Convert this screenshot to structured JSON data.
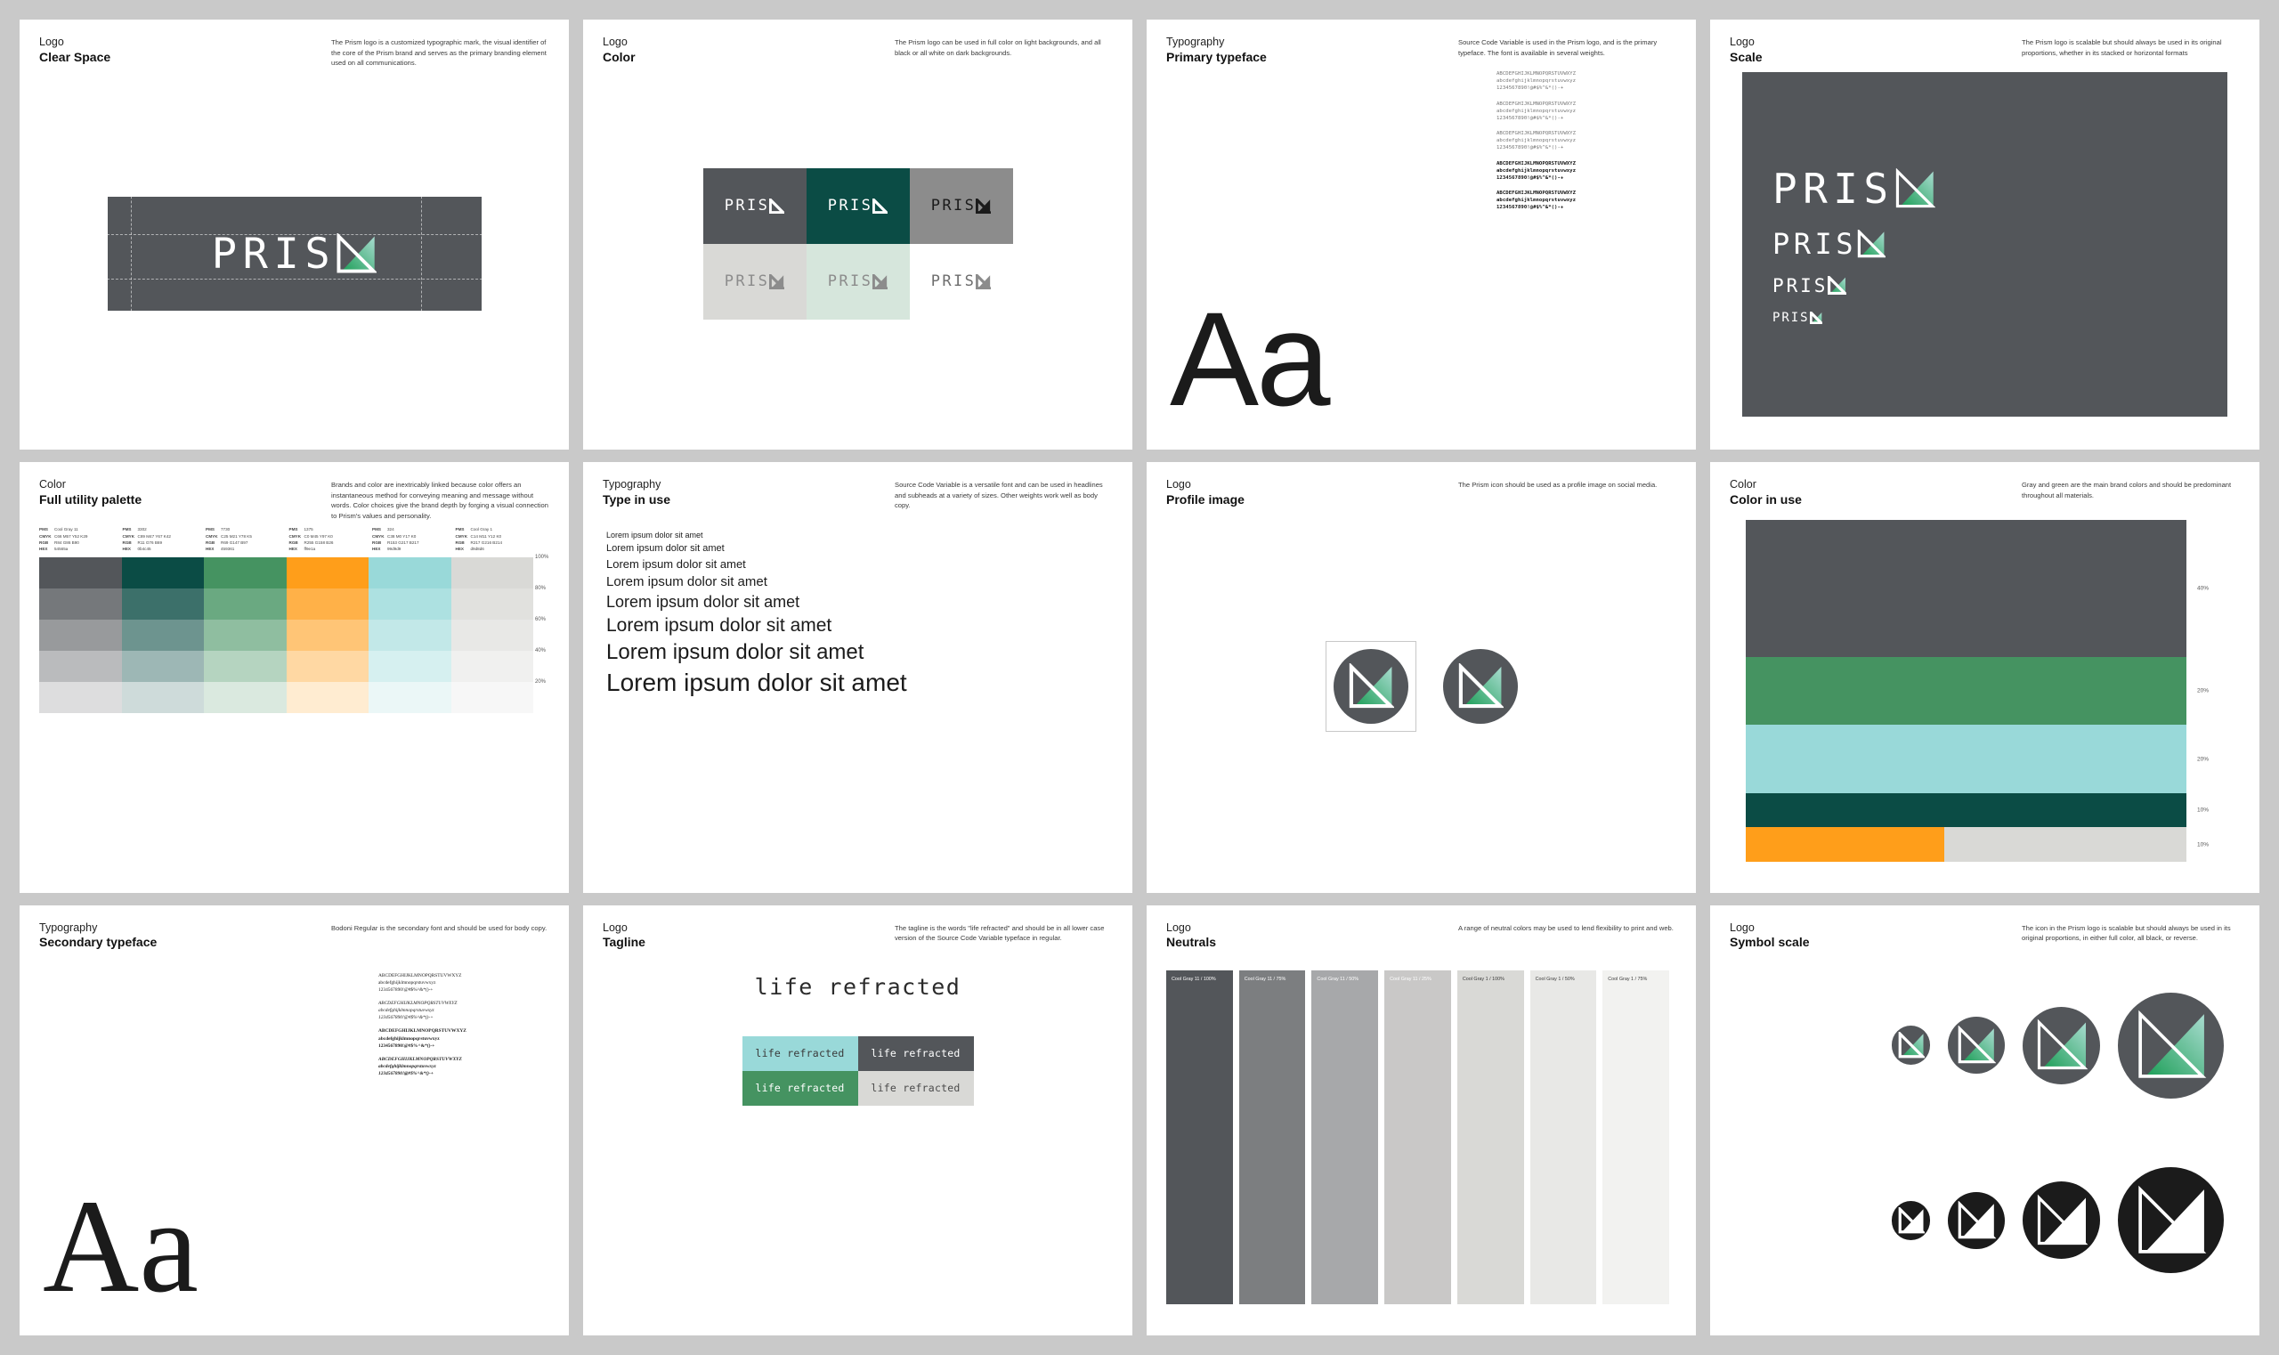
{
  "brand": {
    "name": "Prism",
    "wordmark": "PRIS",
    "tagline": "life refracted"
  },
  "colors": {
    "cool_gray_11": "#53565a",
    "dark_green": "#0b4c45",
    "green": "#459361",
    "orange": "#ff9e1a",
    "light_blue": "#99d9d9",
    "cool_gray_1": "#d9d9d6",
    "mark_green": "#1c9e57",
    "mark_teal": "#8fd2c4",
    "white": "#ffffff",
    "black": "#000000"
  },
  "panels": [
    {
      "kicker": "Logo",
      "title": "Clear Space",
      "desc": "The Prism logo is a customized typographic mark, the visual identifier of the core of the Prism brand and serves as the primary branding element used on all communications."
    },
    {
      "kicker": "Logo",
      "title": "Color",
      "desc": "The Prism logo can be used in full color on light backgrounds, and all black or all white on dark backgrounds.",
      "cells": [
        {
          "bg": "#53565a",
          "fg": "#ffffff",
          "mark": "white"
        },
        {
          "bg": "#0b4c45",
          "fg": "#ffffff",
          "mark": "white"
        },
        {
          "bg": "#8c8c8c",
          "fg": "#1b1b1b",
          "mark": "black"
        },
        {
          "bg": "#d9d9d6",
          "fg": "#8c8c8c",
          "mark": "gray"
        },
        {
          "bg": "#d6e6dc",
          "fg": "#8c8c8c",
          "mark": "gray"
        },
        {
          "bg": "#ffffff",
          "fg": "#6e6e6e",
          "mark": "gray"
        }
      ]
    },
    {
      "kicker": "Typography",
      "title": "Primary typeface",
      "desc": "Source Code Variable  is used in the Prism logo, and is the primary typeface. The font is available in several weights.",
      "sample": "Aa",
      "specimens": [
        {
          "weight": "light",
          "lines": [
            "ABCDEFGHIJKLMNOPQRSTUVWXYZ",
            "abcdefghijklmnopqrstuvwxyz",
            "1234567890!@#$%^&*()-+"
          ]
        },
        {
          "weight": "regular",
          "lines": [
            "ABCDEFGHIJKLMNOPQRSTUVWXYZ",
            "abcdefghijklmnopqrstuvwxyz",
            "1234567890!@#$%^&*()-+"
          ]
        },
        {
          "weight": "medium",
          "lines": [
            "ABCDEFGHIJKLMNOPQRSTUVWXYZ",
            "abcdefghijklmnopqrstuvwxyz",
            "1234567890!@#$%^&*()-+"
          ]
        },
        {
          "weight": "semibold",
          "lines": [
            "ABCDEFGHIJKLMNOPQRSTUVWXYZ",
            "abcdefghijklmnopqrstuvwxyz",
            "1234567890!@#$%^&*()-+"
          ]
        },
        {
          "weight": "bold",
          "lines": [
            "ABCDEFGHIJKLMNOPQRSTUVWXYZ",
            "abcdefghijklmnopqrstuvwxyz",
            "1234567890!@#$%^&*()-+"
          ]
        }
      ]
    },
    {
      "kicker": "Logo",
      "title": "Scale",
      "desc": "The Prism logo is scalable but should always be used in its original proportions, whether in its stacked or horizontal formats",
      "sizes": [
        46,
        32,
        21,
        14
      ]
    },
    {
      "kicker": "Color",
      "title": "Full utility palette",
      "desc": "Brands and color are inextricably linked because color offers an instantaneous method for conveying meaning and message without words. Color choices give the brand depth by forging a visual connection to Prism's values and personality.",
      "swatches": [
        {
          "pms": "Cool Gray 11",
          "cmyk": "C66 M57 Y52 K29",
          "rgb": "R84 G86 B90",
          "hex": "54565a",
          "color": "#53565a"
        },
        {
          "pms": "3302",
          "cmyk": "C89 M47 Y67 K42",
          "rgb": "R11 G76 B69",
          "hex": "0b4c45",
          "color": "#0b4c45"
        },
        {
          "pms": "7730",
          "cmyk": "C25 M21 Y78 K5",
          "rgb": "R69 G147 B97",
          "hex": "459361",
          "color": "#459361"
        },
        {
          "pms": "1375",
          "cmyk": "C0 M45 Y97 K0",
          "rgb": "R255 G158 B26",
          "hex": "ff9e1a",
          "color": "#ff9e1a"
        },
        {
          "pms": "324",
          "cmyk": "C38 M0 Y17 K0",
          "rgb": "R153 G217 B217",
          "hex": "99d9d9",
          "color": "#99d9d9"
        },
        {
          "pms": "Cool Gray 1",
          "cmyk": "C14 M11 Y12 K0",
          "rgb": "R217 G216 B214",
          "hex": "d9d8d6",
          "color": "#d9d9d6"
        }
      ],
      "tints": [
        "100%",
        "80%",
        "60%",
        "40%",
        "20%"
      ]
    },
    {
      "kicker": "Typography",
      "title": "Type in use",
      "desc": "Source Code Variable is a versatile font and can be used in headlines and subheads at a variety of sizes. Other weights work well as body copy.",
      "lines": [
        {
          "text": "Lorem ipsum dolor sit amet",
          "size": 9
        },
        {
          "text": "Lorem ipsum dolor sit amet",
          "size": 11
        },
        {
          "text": "Lorem ipsum dolor sit amet",
          "size": 13
        },
        {
          "text": "Lorem ipsum dolor sit amet",
          "size": 15
        },
        {
          "text": "Lorem ipsum dolor sit amet",
          "size": 18
        },
        {
          "text": "Lorem ipsum dolor sit amet",
          "size": 21
        },
        {
          "text": "Lorem ipsum dolor sit amet",
          "size": 24
        },
        {
          "text": "Lorem ipsum dolor sit amet",
          "size": 28
        }
      ]
    },
    {
      "kicker": "Logo",
      "title": "Profile image",
      "desc": "The Prism icon should be used as a profile image on social media."
    },
    {
      "kicker": "Color",
      "title": "Color in use",
      "desc": "Gray and green are the main brand colors and should be predominant throughout all materials.",
      "bands": [
        {
          "label": "40%",
          "color": "#53565a",
          "weight": 40
        },
        {
          "label": "20%",
          "color": "#459361",
          "weight": 20
        },
        {
          "label": "20%",
          "color": "#99d9d9",
          "weight": 20
        },
        {
          "label": "10%",
          "color": "#0b4c45",
          "weight": 10
        },
        {
          "label": "10%",
          "color": "#d9d9d6",
          "weight": 10,
          "accent": "#ff9e1a"
        }
      ]
    },
    {
      "kicker": "Typography",
      "title": "Secondary typeface",
      "desc": "Bodoni Regular is the secondary font and should be used for body copy.",
      "sample": "Aa",
      "specimens": [
        {
          "style": "regular",
          "lines": [
            "ABCDEFGHIJKLMNOPQRSTUVWXYZ",
            "abcdefghijklmnopqrstuvwxyz",
            "1234567890!@#$%^&*()-+"
          ]
        },
        {
          "style": "italic",
          "lines": [
            "ABCDEFGHIJKLMNOPQRSTUVWXYZ",
            "abcdefghijklmnopqrstuvwxyz",
            "1234567890!@#$%^&*()-+"
          ]
        },
        {
          "style": "bold",
          "lines": [
            "ABCDEFGHIJKLMNOPQRSTUVWXYZ",
            "abcdefghijklmnopqrstuvwxyz",
            "1234567890!@#$%^&*()-+"
          ]
        },
        {
          "style": "bold-italic",
          "lines": [
            "ABCDEFGHIJKLMNOPQRSTUVWXYZ",
            "abcdefghijklmnopqrstuvwxyz",
            "1234567890!@#$%^&*()-+"
          ]
        }
      ]
    },
    {
      "kicker": "Logo",
      "title": "Tagline",
      "desc": "The tagline is the words \"life refracted\" and should be in all lower case version of the Source Code Variable typeface in regular.",
      "cells": [
        {
          "bg": "#99d9d9",
          "fg": "#3a3a3a"
        },
        {
          "bg": "#53565a",
          "fg": "#ffffff"
        },
        {
          "bg": "#459361",
          "fg": "#ffffff"
        },
        {
          "bg": "#d9d9d6",
          "fg": "#4a4a4a"
        }
      ]
    },
    {
      "kicker": "Logo",
      "title": "Neutrals",
      "desc": "A range of neutral colors may be used to lend flexibility to print and web.",
      "swatches": [
        {
          "label": "Cool Gray 11 / 100%",
          "color": "#53565a",
          "fg": "#ffffff"
        },
        {
          "label": "Cool Gray 11 / 75%",
          "color": "#7c7e80",
          "fg": "#ffffff"
        },
        {
          "label": "Cool Gray 11 / 50%",
          "color": "#a7a8aa",
          "fg": "#ffffff"
        },
        {
          "label": "Cool Gray 11 / 25%",
          "color": "#c9c8c7",
          "fg": "#ffffff"
        },
        {
          "label": "Cool Gray 1 / 100%",
          "color": "#d9d9d6",
          "fg": "#3a3a3a"
        },
        {
          "label": "Cool Gray 1 / 50%",
          "color": "#e8e8e6",
          "fg": "#3a3a3a"
        },
        {
          "label": "Cool Gray 1 / 75%",
          "color": "#f2f2f0",
          "fg": "#3a3a3a"
        }
      ]
    },
    {
      "kicker": "Logo",
      "title": "Symbol scale",
      "desc": "The icon in the Prism logo is scalable but should always be used in its original proportions, in either full color, all black, or reverse.",
      "row1": {
        "variant": "color",
        "bg": "#53565a",
        "sizes": [
          30,
          44,
          60,
          82
        ]
      },
      "row2": {
        "variant": "reverse",
        "bg": "#1b1b1b",
        "sizes": [
          30,
          44,
          60,
          82
        ]
      }
    }
  ]
}
